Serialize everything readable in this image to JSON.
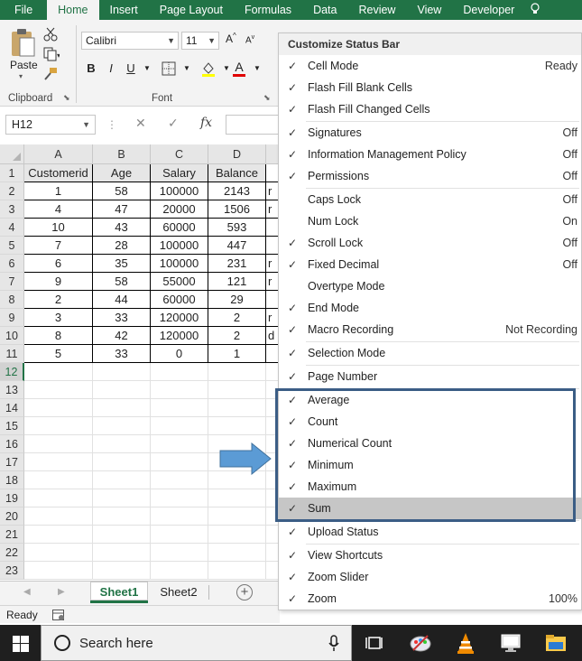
{
  "ribbon": {
    "tabs": [
      "File",
      "Home",
      "Insert",
      "Page Layout",
      "Formulas",
      "Data",
      "Review",
      "View",
      "Developer"
    ],
    "active_tab": "Home",
    "clipboard": {
      "paste_label": "Paste",
      "group_label": "Clipboard"
    },
    "font": {
      "name": "Calibri",
      "size": "11",
      "group_label": "Font",
      "bold": "B",
      "italic": "I",
      "underline": "U",
      "grow": "A",
      "shrink": "A",
      "color_glyph": "A"
    }
  },
  "formula_bar": {
    "cell_ref": "H12",
    "fx": "fx",
    "cancel": "✕",
    "enter": "✓"
  },
  "sheet": {
    "columns": [
      "A",
      "B",
      "C",
      "D"
    ],
    "rows": [
      "1",
      "2",
      "3",
      "4",
      "5",
      "6",
      "7",
      "8",
      "9",
      "10",
      "11",
      "12",
      "13",
      "14",
      "15",
      "16",
      "17",
      "18",
      "19",
      "20",
      "21",
      "22",
      "23"
    ],
    "header": [
      "Customerid",
      "Age",
      "Salary",
      "Balance"
    ],
    "data": [
      [
        "1",
        "58",
        "100000",
        "2143"
      ],
      [
        "4",
        "47",
        "20000",
        "1506"
      ],
      [
        "10",
        "43",
        "60000",
        "593"
      ],
      [
        "7",
        "28",
        "100000",
        "447"
      ],
      [
        "6",
        "35",
        "100000",
        "231"
      ],
      [
        "9",
        "58",
        "55000",
        "121"
      ],
      [
        "2",
        "44",
        "60000",
        "29"
      ],
      [
        "3",
        "33",
        "120000",
        "2"
      ],
      [
        "8",
        "42",
        "120000",
        "2"
      ],
      [
        "5",
        "33",
        "0",
        "1"
      ]
    ],
    "column_e_fragments": [
      "",
      "r",
      "r",
      "",
      "",
      "r",
      "r",
      "",
      "r",
      "d",
      ""
    ],
    "tabs": [
      "Sheet1",
      "Sheet2"
    ],
    "active_tab": "Sheet1",
    "add_tab": "+"
  },
  "status": {
    "mode": "Ready"
  },
  "menu": {
    "title": "Customize Status Bar",
    "items": [
      {
        "label": "Cell Mode",
        "value": "Ready",
        "checked": "✓"
      },
      {
        "label": "Flash Fill Blank Cells",
        "value": "",
        "checked": "✓"
      },
      {
        "label": "Flash Fill Changed Cells",
        "value": "",
        "checked": "✓"
      },
      {
        "label": "Signatures",
        "value": "Off",
        "checked": "✓"
      },
      {
        "label": "Information Management Policy",
        "value": "Off",
        "checked": "✓"
      },
      {
        "label": "Permissions",
        "value": "Off",
        "checked": "✓"
      },
      {
        "label": "Caps Lock",
        "value": "Off",
        "checked": ""
      },
      {
        "label": "Num Lock",
        "value": "On",
        "checked": ""
      },
      {
        "label": "Scroll Lock",
        "value": "Off",
        "checked": "✓"
      },
      {
        "label": "Fixed Decimal",
        "value": "Off",
        "checked": "✓"
      },
      {
        "label": "Overtype Mode",
        "value": "",
        "checked": ""
      },
      {
        "label": "End Mode",
        "value": "",
        "checked": "✓"
      },
      {
        "label": "Macro Recording",
        "value": "Not Recording",
        "checked": "✓"
      },
      {
        "label": "Selection Mode",
        "value": "",
        "checked": "✓"
      },
      {
        "label": "Page Number",
        "value": "",
        "checked": "✓"
      },
      {
        "label": "Average",
        "value": "",
        "checked": "✓"
      },
      {
        "label": "Count",
        "value": "",
        "checked": "✓"
      },
      {
        "label": "Numerical Count",
        "value": "",
        "checked": "✓"
      },
      {
        "label": "Minimum",
        "value": "",
        "checked": "✓"
      },
      {
        "label": "Maximum",
        "value": "",
        "checked": "✓"
      },
      {
        "label": "Sum",
        "value": "",
        "checked": "✓"
      },
      {
        "label": "Upload Status",
        "value": "",
        "checked": "✓"
      },
      {
        "label": "View Shortcuts",
        "value": "",
        "checked": "✓"
      },
      {
        "label": "Zoom Slider",
        "value": "",
        "checked": "✓"
      },
      {
        "label": "Zoom",
        "value": "100%",
        "checked": "✓"
      }
    ],
    "highlighted": "Sum"
  },
  "taskbar": {
    "search_placeholder": "Search here"
  },
  "colors": {
    "excel_green": "#217346",
    "highlight_box": "#3b5d85",
    "arrow": "#5b9bd5"
  }
}
